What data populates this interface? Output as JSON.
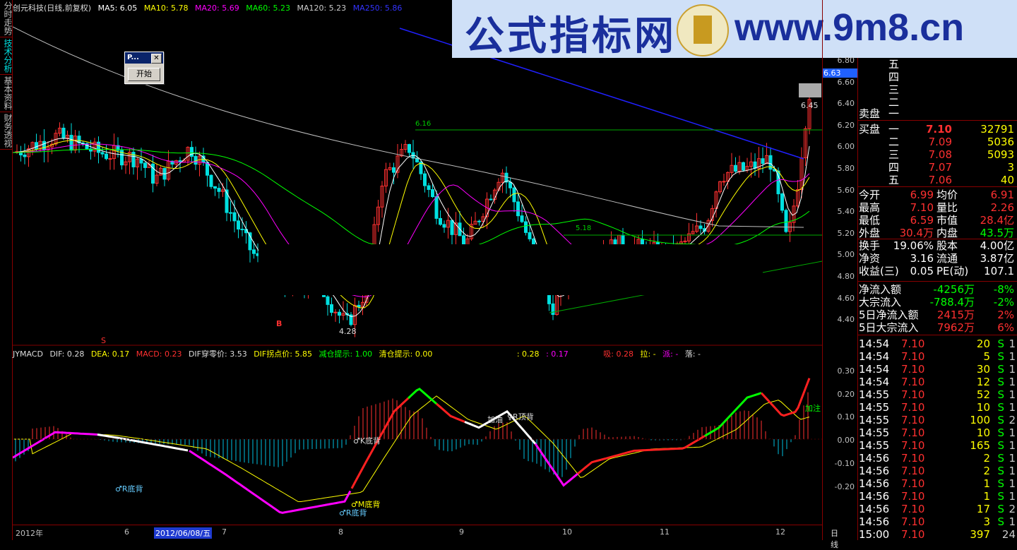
{
  "leftnav": [
    "分时走势",
    "技术分析",
    "基本资料",
    "财务透视"
  ],
  "topbar": {
    "title": "创元科技(日线,前复权)",
    "ma5": "MA5: 6.05",
    "ma10": "MA10: 5.78",
    "ma20": "MA20: 5.69",
    "ma60": "MA60: 5.23",
    "ma120": "MA120: 5.23",
    "ma250": "MA250: 5.86"
  },
  "dialog": {
    "title": "P...",
    "close": "✕",
    "start": "开始"
  },
  "banner": {
    "text1": "公式指标网",
    "text2": "www.9m8.cn"
  },
  "price_tags": {
    "current": "6.63",
    "level_645": "6.45",
    "level_616": "6.16",
    "level_518": "5.18",
    "low_428": "4.28"
  },
  "price_axis": [
    "6.80",
    "6.60",
    "6.40",
    "6.20",
    "6.00",
    "5.80",
    "5.60",
    "5.40",
    "5.20",
    "5.00",
    "4.80",
    "4.60",
    "4.40"
  ],
  "macd_axis": [
    "0.30",
    "0.20",
    "0.10",
    "0.00",
    "-0.10",
    "-0.20"
  ],
  "macdbar": {
    "name": "JYMACD",
    "dif": "DIF: 0.28",
    "dea": "DEA: 0.17",
    "macd": "MACD: 0.23",
    "dif_cross": "DIF穿零价: 3.53",
    "dif_turn": "DIF拐点价: 5.85",
    "reduce": "减仓提示: 1.00",
    "clear": "清仓提示: 0.00",
    "v1": ": 0.28",
    "v2": ": 0.17",
    "xi": "吸: 0.28",
    "la": "拉: -",
    "pai": "派: -",
    "luo": "落: -"
  },
  "macd_labels": {
    "r_bottom1": "♂R底背",
    "k_bottom": "♂K底背",
    "add": "加油",
    "top": "♀R顶背",
    "m_bottom": "♂M底背",
    "r_bottom2": "♂R底背",
    "jiazhu": "加注",
    "b": "B",
    "s": "S"
  },
  "dates": {
    "y2012": "2012年",
    "m6": "6",
    "sel": "2012/06/08/五",
    "m7": "7",
    "m8": "8",
    "m9": "9",
    "m10": "10",
    "m11": "11",
    "m12": "12",
    "period": "日线"
  },
  "orderbook": {
    "sell": [
      [
        "五",
        "",
        ""
      ],
      [
        "四",
        "",
        ""
      ],
      [
        "三",
        "",
        ""
      ],
      [
        "二",
        "",
        ""
      ],
      [
        "一",
        "",
        ""
      ]
    ],
    "sell_label": "卖盘",
    "buy_label": "买盘",
    "buy": [
      [
        "一",
        "7.10",
        "32791"
      ],
      [
        "二",
        "7.09",
        "5036"
      ],
      [
        "三",
        "7.08",
        "5093"
      ],
      [
        "四",
        "7.07",
        "3"
      ],
      [
        "五",
        "7.06",
        "40"
      ]
    ]
  },
  "stats": [
    [
      "今开",
      "6.99",
      "均价",
      "6.91"
    ],
    [
      "最高",
      "7.10",
      "量比",
      "2.26"
    ],
    [
      "最低",
      "6.59",
      "市值",
      "28.4亿"
    ],
    [
      "外盘",
      "30.4万",
      "内盘",
      "43.5万"
    ],
    [
      "换手",
      "19.06%",
      "股本",
      "4.00亿"
    ],
    [
      "净资",
      "3.16",
      "流通",
      "3.87亿"
    ],
    [
      "收益(三)",
      "0.05",
      "PE(动)",
      "107.1"
    ]
  ],
  "flows": [
    [
      "净流入额",
      "-4256万",
      "-8%"
    ],
    [
      "大宗流入",
      "-788.4万",
      "-2%"
    ],
    [
      "5日净流入额",
      "2415万",
      "2%"
    ],
    [
      "5日大宗流入",
      "7962万",
      "6%"
    ]
  ],
  "ticks": [
    [
      "14:54",
      "7.10",
      "20",
      "S",
      "1"
    ],
    [
      "14:54",
      "7.10",
      "5",
      "S",
      "1"
    ],
    [
      "14:54",
      "7.10",
      "30",
      "S",
      "1"
    ],
    [
      "14:54",
      "7.10",
      "12",
      "S",
      "1"
    ],
    [
      "14:55",
      "7.10",
      "52",
      "S",
      "1"
    ],
    [
      "14:55",
      "7.10",
      "10",
      "S",
      "1"
    ],
    [
      "14:55",
      "7.10",
      "100",
      "S",
      "2"
    ],
    [
      "14:55",
      "7.10",
      "10",
      "S",
      "1"
    ],
    [
      "14:55",
      "7.10",
      "165",
      "S",
      "1"
    ],
    [
      "14:56",
      "7.10",
      "2",
      "S",
      "1"
    ],
    [
      "14:56",
      "7.10",
      "2",
      "S",
      "1"
    ],
    [
      "14:56",
      "7.10",
      "1",
      "S",
      "1"
    ],
    [
      "14:56",
      "7.10",
      "1",
      "S",
      "1"
    ],
    [
      "14:56",
      "7.10",
      "17",
      "S",
      "2"
    ],
    [
      "14:56",
      "7.10",
      "3",
      "S",
      "1"
    ],
    [
      "15:00",
      "7.10",
      "397",
      "",
      "24"
    ]
  ],
  "colors": {
    "up": "#ff3030",
    "down": "#00e0e0",
    "ma5": "#ffffff",
    "ma10": "#ffff00",
    "ma20": "#ff00ff",
    "ma60": "#00ff00",
    "ma120": "#c0c0c0",
    "ma250": "#2020ff",
    "grid": "#800000"
  }
}
